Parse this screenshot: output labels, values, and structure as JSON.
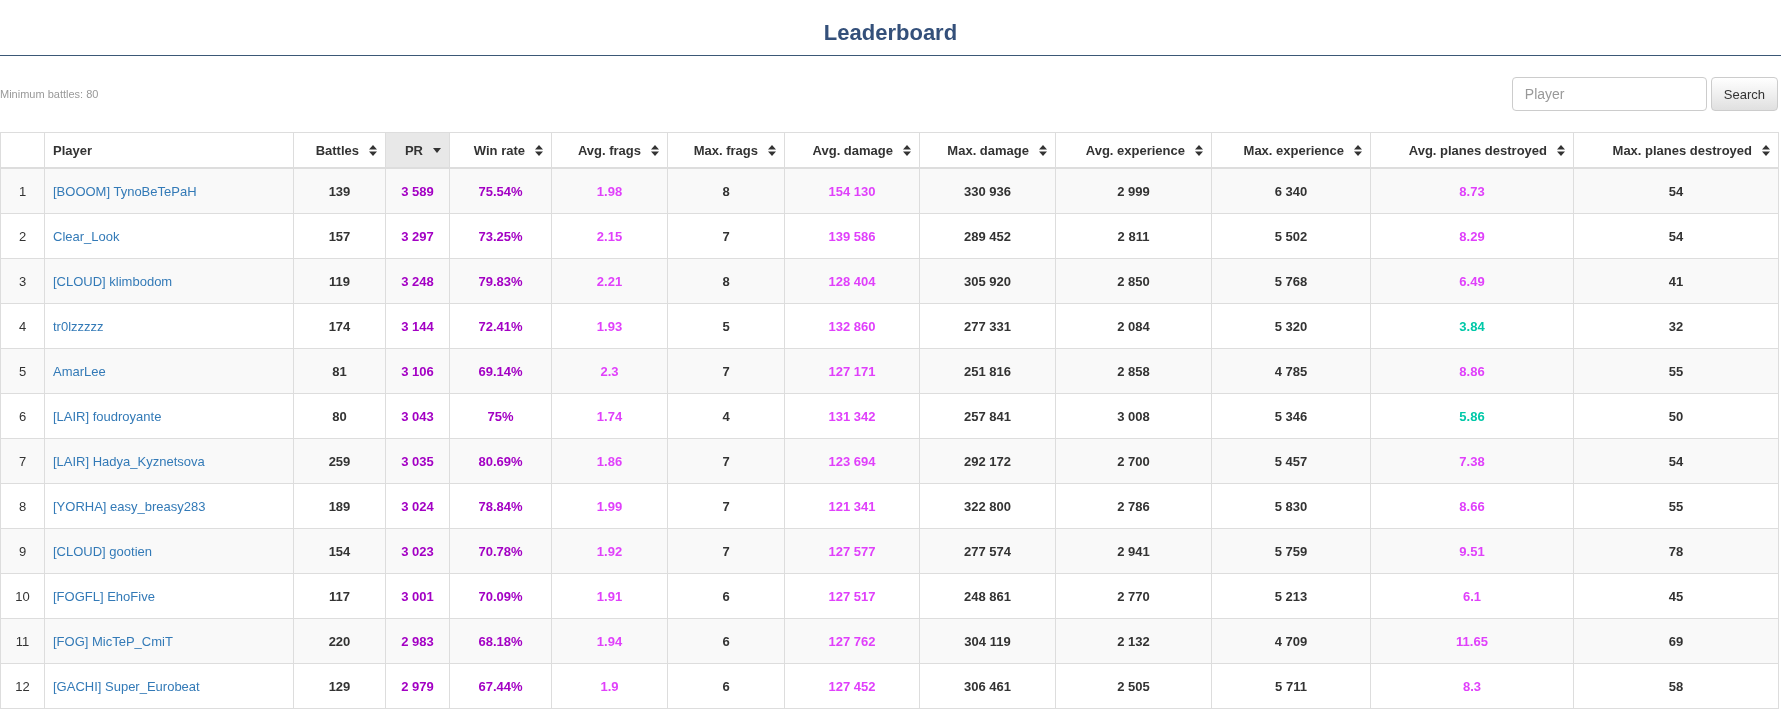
{
  "title": "Leaderboard",
  "minimum_battles": "Minimum battles: 80",
  "search": {
    "placeholder": "Player",
    "button": "Search"
  },
  "columns": [
    {
      "label": "Player",
      "sortable": false,
      "sorted": false
    },
    {
      "label": "Battles",
      "sortable": true,
      "sorted": false
    },
    {
      "label": "PR",
      "sortable": true,
      "sorted": true
    },
    {
      "label": "Win rate",
      "sortable": true,
      "sorted": false
    },
    {
      "label": "Avg. frags",
      "sortable": true,
      "sorted": false
    },
    {
      "label": "Max. frags",
      "sortable": true,
      "sorted": false
    },
    {
      "label": "Avg. damage",
      "sortable": true,
      "sorted": false
    },
    {
      "label": "Max. damage",
      "sortable": true,
      "sorted": false
    },
    {
      "label": "Avg. experience",
      "sortable": true,
      "sorted": false
    },
    {
      "label": "Max. experience",
      "sortable": true,
      "sorted": false
    },
    {
      "label": "Avg. planes destroyed",
      "sortable": true,
      "sorted": false
    },
    {
      "label": "Max. planes destroyed",
      "sortable": true,
      "sorted": false
    }
  ],
  "rows": [
    {
      "rank": "1",
      "player": "[BOOOM] TynoBeTePaH",
      "values": [
        {
          "text": "139"
        },
        {
          "text": "3 589",
          "color": "#a300c4"
        },
        {
          "text": "75.54%",
          "color": "#a300c4"
        },
        {
          "text": "1.98",
          "color": "#e040fb"
        },
        {
          "text": "8"
        },
        {
          "text": "154 130",
          "color": "#e040fb"
        },
        {
          "text": "330 936"
        },
        {
          "text": "2 999"
        },
        {
          "text": "6 340"
        },
        {
          "text": "8.73",
          "color": "#e040fb"
        },
        {
          "text": "54"
        }
      ]
    },
    {
      "rank": "2",
      "player": "Clear_Look",
      "values": [
        {
          "text": "157"
        },
        {
          "text": "3 297",
          "color": "#a300c4"
        },
        {
          "text": "73.25%",
          "color": "#a300c4"
        },
        {
          "text": "2.15",
          "color": "#e040fb"
        },
        {
          "text": "7"
        },
        {
          "text": "139 586",
          "color": "#e040fb"
        },
        {
          "text": "289 452"
        },
        {
          "text": "2 811"
        },
        {
          "text": "5 502"
        },
        {
          "text": "8.29",
          "color": "#e040fb"
        },
        {
          "text": "54"
        }
      ]
    },
    {
      "rank": "3",
      "player": "[CLOUD] klimbodom",
      "values": [
        {
          "text": "119"
        },
        {
          "text": "3 248",
          "color": "#a300c4"
        },
        {
          "text": "79.83%",
          "color": "#a300c4"
        },
        {
          "text": "2.21",
          "color": "#e040fb"
        },
        {
          "text": "8"
        },
        {
          "text": "128 404",
          "color": "#e040fb"
        },
        {
          "text": "305 920"
        },
        {
          "text": "2 850"
        },
        {
          "text": "5 768"
        },
        {
          "text": "6.49",
          "color": "#e040fb"
        },
        {
          "text": "41"
        }
      ]
    },
    {
      "rank": "4",
      "player": "tr0lzzzzz",
      "values": [
        {
          "text": "174"
        },
        {
          "text": "3 144",
          "color": "#a300c4"
        },
        {
          "text": "72.41%",
          "color": "#a300c4"
        },
        {
          "text": "1.93",
          "color": "#e040fb"
        },
        {
          "text": "5"
        },
        {
          "text": "132 860",
          "color": "#e040fb"
        },
        {
          "text": "277 331"
        },
        {
          "text": "2 084"
        },
        {
          "text": "5 320"
        },
        {
          "text": "3.84",
          "color": "#00c8a8"
        },
        {
          "text": "32"
        }
      ]
    },
    {
      "rank": "5",
      "player": "AmarLee",
      "values": [
        {
          "text": "81"
        },
        {
          "text": "3 106",
          "color": "#a300c4"
        },
        {
          "text": "69.14%",
          "color": "#a300c4"
        },
        {
          "text": "2.3",
          "color": "#e040fb"
        },
        {
          "text": "7"
        },
        {
          "text": "127 171",
          "color": "#e040fb"
        },
        {
          "text": "251 816"
        },
        {
          "text": "2 858"
        },
        {
          "text": "4 785"
        },
        {
          "text": "8.86",
          "color": "#e040fb"
        },
        {
          "text": "55"
        }
      ]
    },
    {
      "rank": "6",
      "player": "[LAIR] foudroyante",
      "values": [
        {
          "text": "80"
        },
        {
          "text": "3 043",
          "color": "#a300c4"
        },
        {
          "text": "75%",
          "color": "#a300c4"
        },
        {
          "text": "1.74",
          "color": "#e040fb"
        },
        {
          "text": "4"
        },
        {
          "text": "131 342",
          "color": "#e040fb"
        },
        {
          "text": "257 841"
        },
        {
          "text": "3 008"
        },
        {
          "text": "5 346"
        },
        {
          "text": "5.86",
          "color": "#00c8a8"
        },
        {
          "text": "50"
        }
      ]
    },
    {
      "rank": "7",
      "player": "[LAIR] Hadya_Kyznetsova",
      "values": [
        {
          "text": "259"
        },
        {
          "text": "3 035",
          "color": "#a300c4"
        },
        {
          "text": "80.69%",
          "color": "#a300c4"
        },
        {
          "text": "1.86",
          "color": "#e040fb"
        },
        {
          "text": "7"
        },
        {
          "text": "123 694",
          "color": "#e040fb"
        },
        {
          "text": "292 172"
        },
        {
          "text": "2 700"
        },
        {
          "text": "5 457"
        },
        {
          "text": "7.38",
          "color": "#e040fb"
        },
        {
          "text": "54"
        }
      ]
    },
    {
      "rank": "8",
      "player": "[YORHA] easy_breasy283",
      "values": [
        {
          "text": "189"
        },
        {
          "text": "3 024",
          "color": "#a300c4"
        },
        {
          "text": "78.84%",
          "color": "#a300c4"
        },
        {
          "text": "1.99",
          "color": "#e040fb"
        },
        {
          "text": "7"
        },
        {
          "text": "121 341",
          "color": "#e040fb"
        },
        {
          "text": "322 800"
        },
        {
          "text": "2 786"
        },
        {
          "text": "5 830"
        },
        {
          "text": "8.66",
          "color": "#e040fb"
        },
        {
          "text": "55"
        }
      ]
    },
    {
      "rank": "9",
      "player": "[CLOUD] gootien",
      "values": [
        {
          "text": "154"
        },
        {
          "text": "3 023",
          "color": "#a300c4"
        },
        {
          "text": "70.78%",
          "color": "#a300c4"
        },
        {
          "text": "1.92",
          "color": "#e040fb"
        },
        {
          "text": "7"
        },
        {
          "text": "127 577",
          "color": "#e040fb"
        },
        {
          "text": "277 574"
        },
        {
          "text": "2 941"
        },
        {
          "text": "5 759"
        },
        {
          "text": "9.51",
          "color": "#e040fb"
        },
        {
          "text": "78"
        }
      ]
    },
    {
      "rank": "10",
      "player": "[FOGFL] EhoFive",
      "values": [
        {
          "text": "117"
        },
        {
          "text": "3 001",
          "color": "#a300c4"
        },
        {
          "text": "70.09%",
          "color": "#a300c4"
        },
        {
          "text": "1.91",
          "color": "#e040fb"
        },
        {
          "text": "6"
        },
        {
          "text": "127 517",
          "color": "#e040fb"
        },
        {
          "text": "248 861"
        },
        {
          "text": "2 770"
        },
        {
          "text": "5 213"
        },
        {
          "text": "6.1",
          "color": "#e040fb"
        },
        {
          "text": "45"
        }
      ]
    },
    {
      "rank": "11",
      "player": "[FOG] MicTeP_CmiT",
      "values": [
        {
          "text": "220"
        },
        {
          "text": "2 983",
          "color": "#a300c4"
        },
        {
          "text": "68.18%",
          "color": "#a300c4"
        },
        {
          "text": "1.94",
          "color": "#e040fb"
        },
        {
          "text": "6"
        },
        {
          "text": "127 762",
          "color": "#e040fb"
        },
        {
          "text": "304 119"
        },
        {
          "text": "2 132"
        },
        {
          "text": "4 709"
        },
        {
          "text": "11.65",
          "color": "#e040fb"
        },
        {
          "text": "69"
        }
      ]
    },
    {
      "rank": "12",
      "player": "[GACHI] Super_Eurobeat",
      "values": [
        {
          "text": "129"
        },
        {
          "text": "2 979",
          "color": "#a300c4"
        },
        {
          "text": "67.44%",
          "color": "#a300c4"
        },
        {
          "text": "1.9",
          "color": "#e040fb"
        },
        {
          "text": "6"
        },
        {
          "text": "127 452",
          "color": "#e040fb"
        },
        {
          "text": "306 461"
        },
        {
          "text": "2 505"
        },
        {
          "text": "5 711"
        },
        {
          "text": "8.3",
          "color": "#e040fb"
        },
        {
          "text": "58"
        }
      ]
    }
  ]
}
